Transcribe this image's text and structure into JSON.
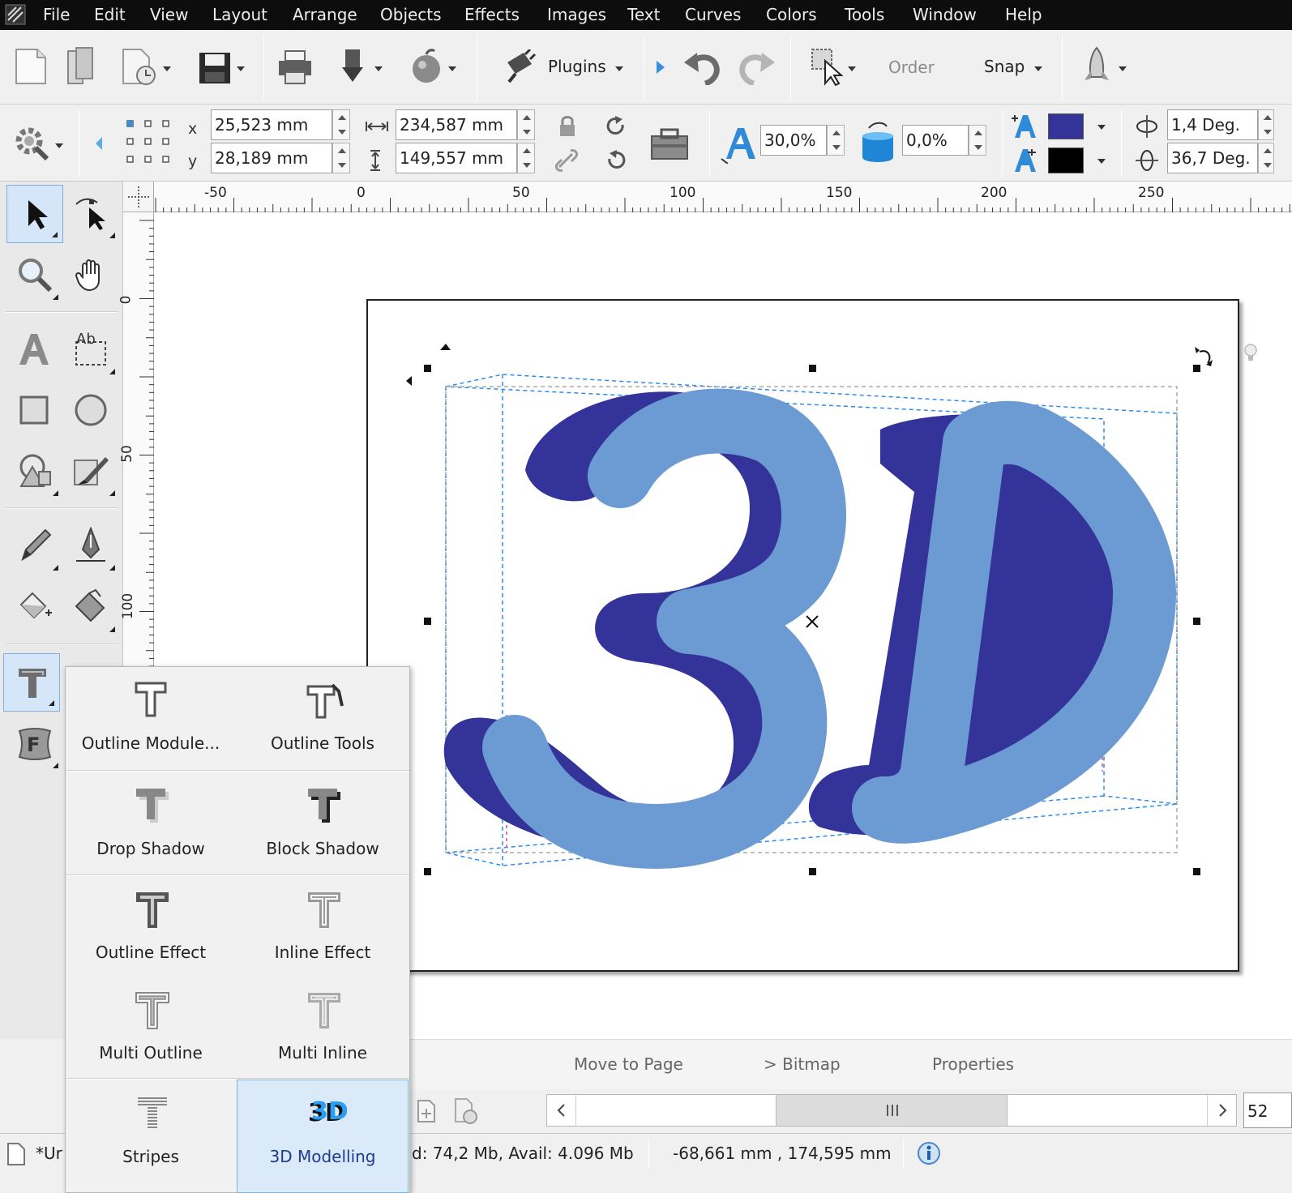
{
  "menu": [
    "File",
    "Edit",
    "View",
    "Layout",
    "Arrange",
    "Objects",
    "Effects",
    "Images",
    "Text",
    "Curves",
    "Colors",
    "Tools",
    "Window",
    "Help"
  ],
  "toolbar": {
    "plugins_label": "Plugins",
    "order_label": "Order",
    "snap_label": "Snap"
  },
  "props": {
    "x_label": "x",
    "y_label": "y",
    "x_value": "25,523 mm",
    "y_value": "28,189 mm",
    "width_value": "234,587 mm",
    "height_value": "149,557 mm",
    "depth_value": "30,0%",
    "perspective_value": "0,0%",
    "fill_color": "#333399",
    "outline_color": "#000000",
    "rotation_x": "1,4 Deg.",
    "rotation_y": "36,7 Deg."
  },
  "rulers": {
    "top": [
      "-50",
      "0",
      "50",
      "100",
      "150",
      "200",
      "250"
    ],
    "left": [
      "0",
      "50",
      "100"
    ]
  },
  "canvas": {
    "text": "3D",
    "front_color": "#6b9bd2",
    "extrude_color": "#333399"
  },
  "popup": {
    "items": [
      {
        "label": "Outline Module..."
      },
      {
        "label": "Outline Tools"
      },
      {
        "label": "Drop Shadow"
      },
      {
        "label": "Block Shadow"
      },
      {
        "label": "Outline Effect"
      },
      {
        "label": "Inline Effect"
      },
      {
        "label": "Multi Outline"
      },
      {
        "label": "Multi Inline"
      },
      {
        "label": "Stripes"
      },
      {
        "label": "3D Modelling"
      }
    ],
    "selected": "3D Modelling"
  },
  "bottom": {
    "move_to_page": "Move to Page",
    "to_bitmap": "> Bitmap",
    "properties": "Properties"
  },
  "nav": {
    "zoom_value": "52"
  },
  "status": {
    "doc_name": "*Ur",
    "memory": "d: 74,2 Mb, Avail: 4.096 Mb",
    "coords": "-68,661 mm , 174,595 mm"
  }
}
